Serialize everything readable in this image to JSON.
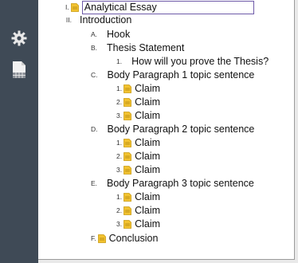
{
  "sidebar": {
    "buttons": [
      {
        "name": "settings",
        "icon": "gear-icon"
      },
      {
        "name": "document",
        "icon": "document-table-icon"
      }
    ]
  },
  "outline": [
    {
      "marker": "I.",
      "text": "Analytical Essay",
      "note": true,
      "selected": true
    },
    {
      "marker": "II.",
      "text": "Introduction",
      "note": false
    },
    {
      "marker": "A.",
      "text": "Hook",
      "note": false
    },
    {
      "marker": "B.",
      "text": "Thesis Statement",
      "note": false
    },
    {
      "marker": "1.",
      "text": "How will you prove the Thesis?",
      "note": false
    },
    {
      "marker": "C.",
      "text": "Body Paragraph 1 topic sentence",
      "note": false
    },
    {
      "marker": "1.",
      "text": "Claim",
      "note": true
    },
    {
      "marker": "2.",
      "text": "Claim",
      "note": true
    },
    {
      "marker": "3.",
      "text": "Claim",
      "note": true
    },
    {
      "marker": "D.",
      "text": "Body Paragraph 2 topic sentence",
      "note": false
    },
    {
      "marker": "1.",
      "text": "Claim",
      "note": true
    },
    {
      "marker": "2.",
      "text": "Claim",
      "note": true
    },
    {
      "marker": "3.",
      "text": "Claim",
      "note": true
    },
    {
      "marker": "E.",
      "text": "Body Paragraph 3 topic sentence",
      "note": false
    },
    {
      "marker": "1.",
      "text": "Claim",
      "note": true
    },
    {
      "marker": "2.",
      "text": "Claim",
      "note": true
    },
    {
      "marker": "3.",
      "text": "Claim",
      "note": true
    },
    {
      "marker": "F.",
      "text": "Conclusion",
      "note": true
    }
  ],
  "colors": {
    "sidebar": "#3f4a56",
    "note_icon": "#f2c230",
    "selection_border": "#6e5aa8"
  }
}
